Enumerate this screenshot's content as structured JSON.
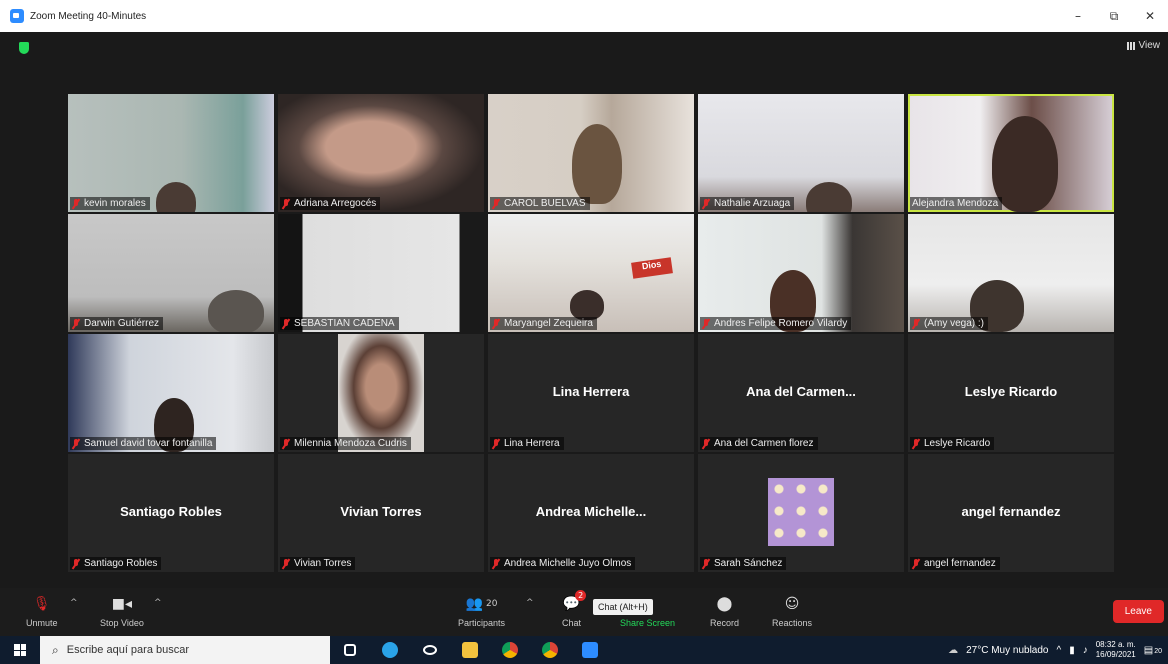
{
  "window": {
    "title": "Zoom Meeting 40-Minutes",
    "controls": {
      "minimize": "–",
      "restore": "⧉",
      "close": "✕"
    }
  },
  "header": {
    "view_label": "View"
  },
  "participants": [
    {
      "name": "kevin morales",
      "big_name": "",
      "video": true
    },
    {
      "name": "Adriana Arregocés",
      "big_name": "",
      "video": true
    },
    {
      "name": "CAROL BUELVAS",
      "big_name": "",
      "video": true
    },
    {
      "name": "Nathalie Arzuaga",
      "big_name": "",
      "video": true
    },
    {
      "name": "Alejandra Mendoza",
      "big_name": "",
      "video": true,
      "active_speaker": true
    },
    {
      "name": "Darwin Gutiérrez",
      "big_name": "",
      "video": true
    },
    {
      "name": "SEBASTIAN CADENA",
      "big_name": "",
      "video": true
    },
    {
      "name": "Maryangel Zequeira",
      "big_name": "",
      "video": true,
      "sign_text": "Dios"
    },
    {
      "name": "Andres Felipe Romero Vilardy",
      "big_name": "",
      "video": true
    },
    {
      "name": "(Amy vega) :)",
      "big_name": "",
      "video": true
    },
    {
      "name": "Samuel david tovar fontanilla",
      "big_name": "",
      "video": true
    },
    {
      "name": "Milennia Mendoza Cudris",
      "big_name": "",
      "video": true
    },
    {
      "name": "Lina Herrera",
      "big_name": "Lina Herrera",
      "video": false
    },
    {
      "name": "Ana del Carmen florez",
      "big_name": "Ana del Carmen...",
      "video": false
    },
    {
      "name": "Leslye Ricardo",
      "big_name": "Leslye Ricardo",
      "video": false
    },
    {
      "name": "Santiago Robles",
      "big_name": "Santiago Robles",
      "video": false
    },
    {
      "name": "Vivian Torres",
      "big_name": "Vivian Torres",
      "video": false
    },
    {
      "name": "Andrea Michelle Juyo Olmos",
      "big_name": "Andrea  Michelle...",
      "video": false
    },
    {
      "name": "Sarah  Sánchez",
      "big_name": "",
      "video": false,
      "avatar": "flower-pattern"
    },
    {
      "name": "angel fernandez",
      "big_name": "angel fernandez",
      "video": false
    }
  ],
  "toolbar": {
    "unmute": "Unmute",
    "stop_video": "Stop Video",
    "participants": "Participants",
    "participants_count": "20",
    "chat": "Chat",
    "chat_badge": "2",
    "chat_tooltip": "Chat (Alt+H)",
    "share_screen": "Share Screen",
    "record": "Record",
    "reactions": "Reactions",
    "leave": "Leave"
  },
  "taskbar": {
    "search_placeholder": "Escribe aquí para buscar",
    "weather": "27°C  Muy nublado",
    "time": "08:32 a. m.",
    "date": "16/09/2021",
    "notification_count": "20"
  }
}
